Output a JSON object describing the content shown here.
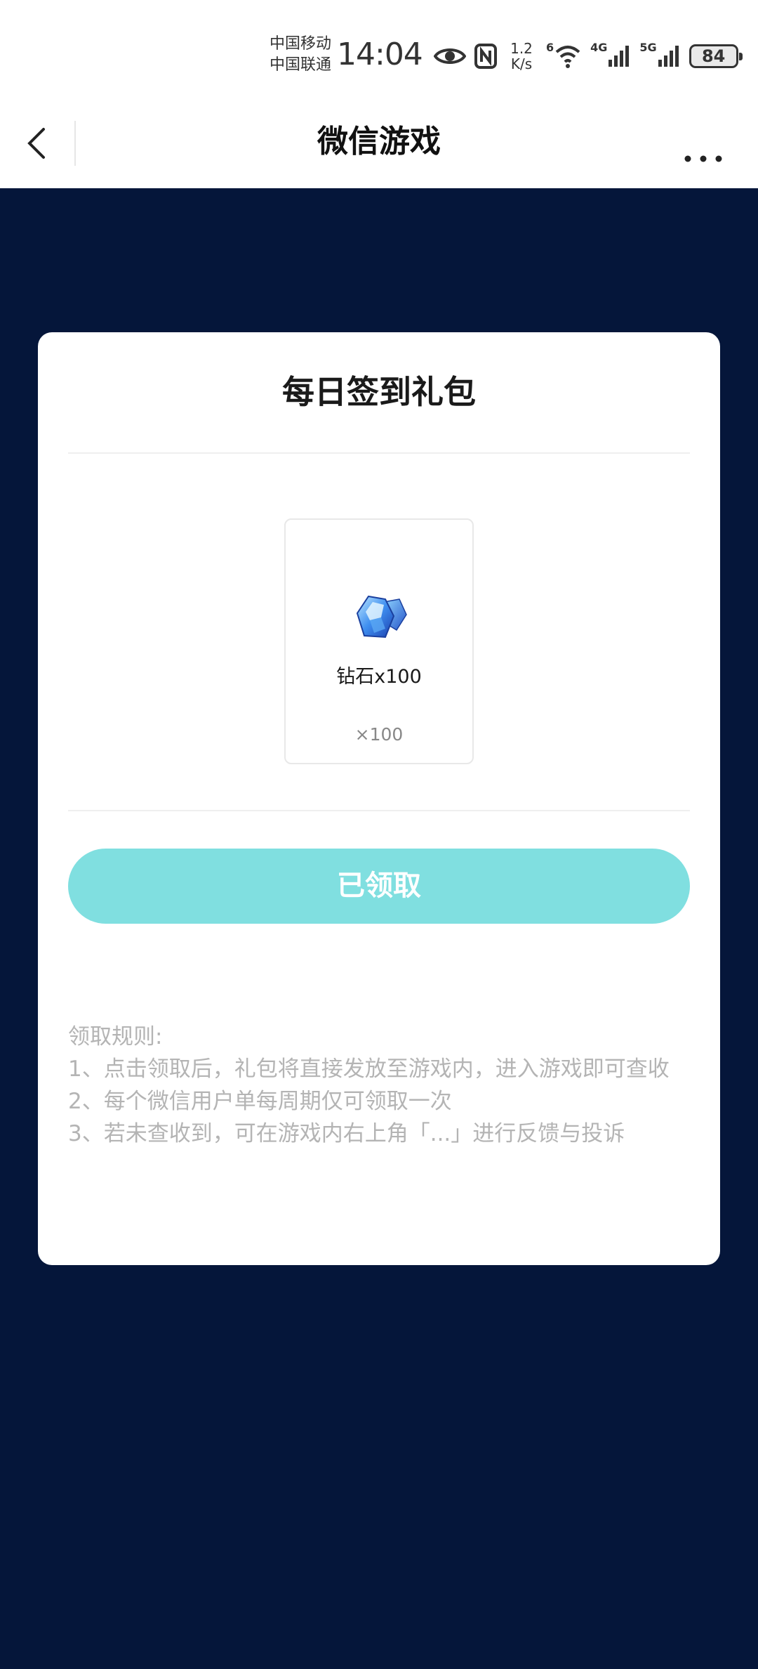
{
  "status_bar": {
    "carrier_1": "中国移动",
    "carrier_2": "中国联通",
    "time": "14:04",
    "net_speed_value": "1.2",
    "net_speed_unit": "K/s",
    "wifi_label": "6",
    "signal_1_label": "4G",
    "signal_2_label": "5G",
    "battery": "84"
  },
  "nav": {
    "title": "微信游戏",
    "back_icon": "chevron-left-icon",
    "more_icon": "more-dots-icon"
  },
  "card": {
    "title": "每日签到礼包",
    "item": {
      "icon": "diamond-gem-icon",
      "name": "钻石x100",
      "quantity": "×100"
    },
    "claim_button": "已领取",
    "rules": {
      "heading": "领取规则:",
      "line_1": "1、点击领取后，礼包将直接发放至游戏内，进入游戏即可查收",
      "line_2": "2、每个微信用户单每周期仅可领取一次",
      "line_3": "3、若未查收到，可在游戏内右上角「...」进行反馈与投诉"
    }
  },
  "colors": {
    "background": "#05163a",
    "button": "#80dfe0",
    "rules_text": "#b4b4b4"
  }
}
